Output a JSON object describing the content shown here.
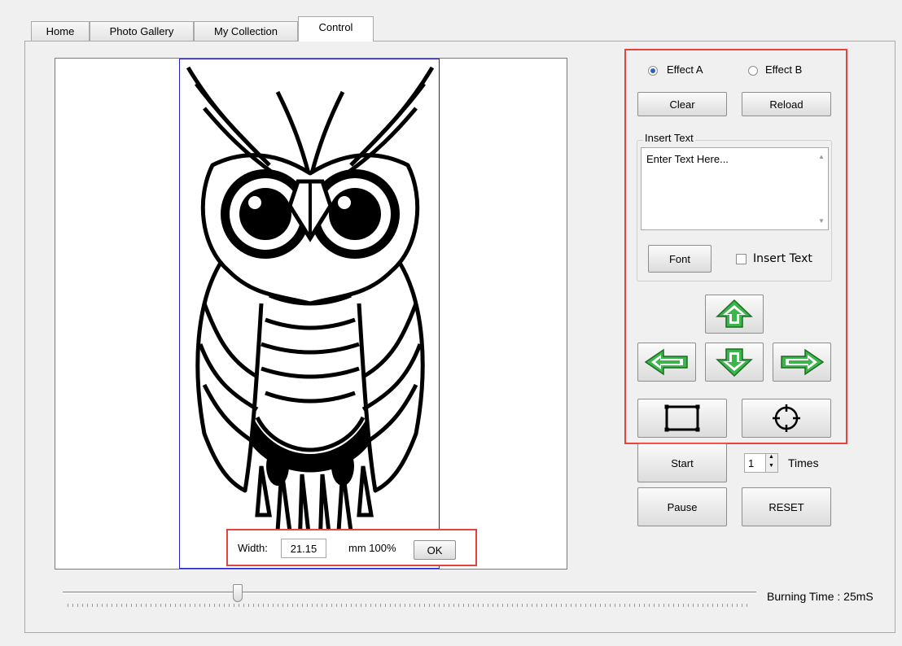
{
  "tabs": [
    {
      "label": "Home"
    },
    {
      "label": "Photo Gallery"
    },
    {
      "label": "My Collection"
    },
    {
      "label": "Control",
      "active": true
    }
  ],
  "width_bar": {
    "label": "Width:",
    "value": "21.15",
    "unit": "mm 100%",
    "ok_label": "OK"
  },
  "effects": {
    "effect_a": "Effect A",
    "effect_b": "Effect B",
    "selected": "Effect A"
  },
  "buttons": {
    "clear": "Clear",
    "reload": "Reload",
    "font": "Font",
    "start": "Start",
    "pause": "Pause",
    "reset": "RESET"
  },
  "insert_text": {
    "group_label": "Insert Text",
    "value": "Enter Text Here...",
    "checkbox_label": "Insert Text",
    "checked": false
  },
  "repeat": {
    "count": "1",
    "unit": "Times"
  },
  "burning": {
    "label": "Burning Time : 25mS",
    "slider_fraction": 0.25
  },
  "icons": {
    "up": "arrow-up-icon",
    "down": "arrow-down-icon",
    "left": "arrow-left-icon",
    "right": "arrow-right-icon",
    "frame": "frame-rectangle-icon",
    "center": "crosshair-icon"
  },
  "colors": {
    "highlight_outline": "#e8423c",
    "arrow_fill": "#3cb54a",
    "image_frame": "#2020c0"
  }
}
